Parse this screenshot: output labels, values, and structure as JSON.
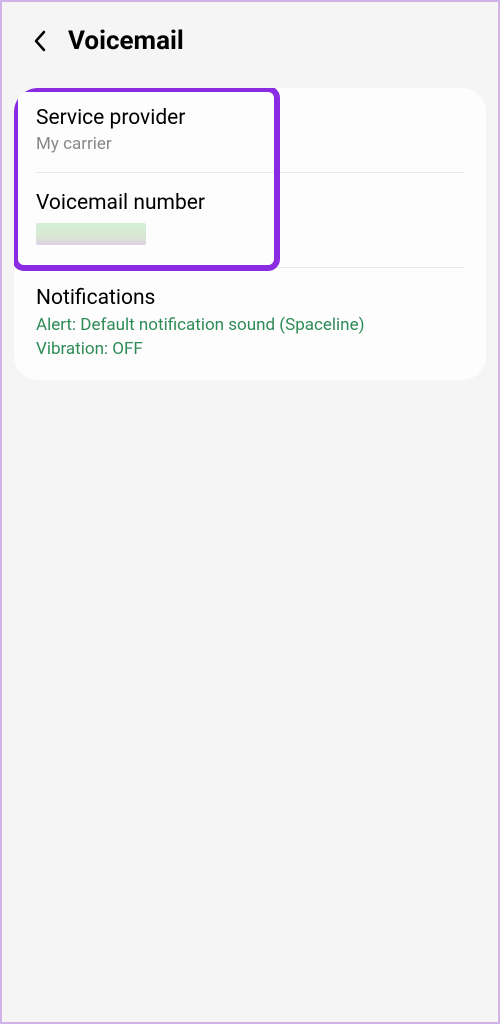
{
  "header": {
    "title": "Voicemail"
  },
  "items": {
    "service_provider": {
      "title": "Service provider",
      "subtitle": "My carrier"
    },
    "voicemail_number": {
      "title": "Voicemail number"
    },
    "notifications": {
      "title": "Notifications",
      "line1": "Alert: Default notification sound (Spaceline)",
      "line2": "Vibration: OFF"
    }
  }
}
